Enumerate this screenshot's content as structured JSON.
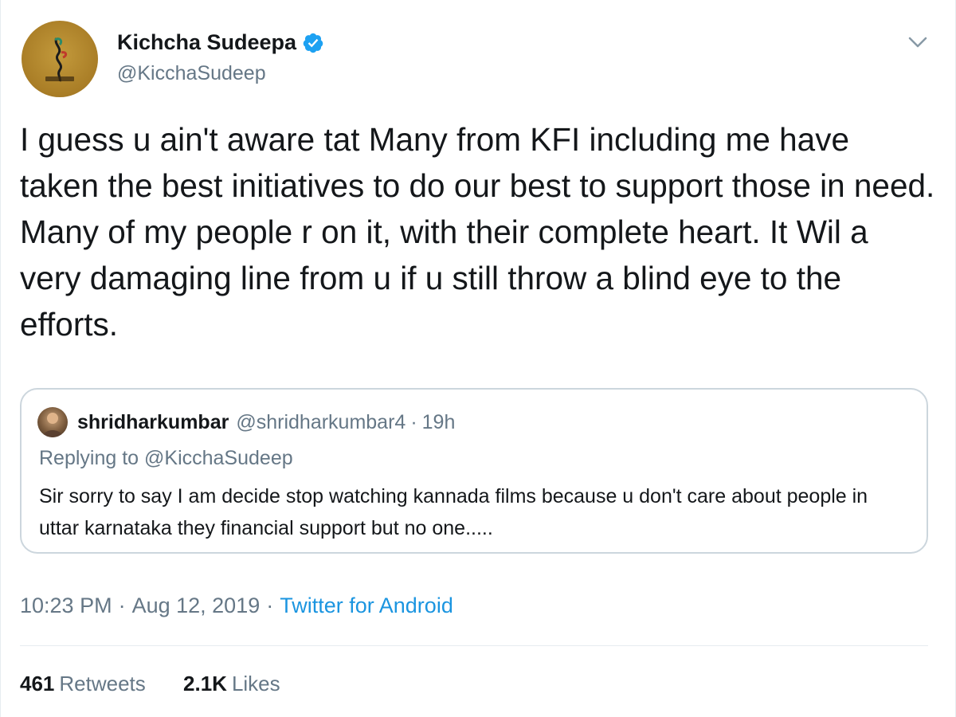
{
  "author": {
    "display_name": "Kichcha Sudeepa",
    "handle": "@KicchaSudeep",
    "avatar_icon": "profile-avatar",
    "verified_icon": "verified-badge-icon",
    "verified_color": "#1da1f2"
  },
  "menu": {
    "icon": "chevron-down-icon"
  },
  "tweet": {
    "text": "I guess u ain't aware tat Many from KFI including me have taken the best initiatives to do our best to support those in need. Many of my people r on it, with their complete heart. It Wil a very damaging line from u if u still throw a blind eye to the efforts."
  },
  "quoted": {
    "display_name": "shridharkumbar",
    "handle": "@shridharkumbar4",
    "separator": "·",
    "time": "19h",
    "replying_to": "Replying to @KicchaSudeep",
    "text": "Sir sorry to say I am decide stop watching kannada films because u don't care about people in uttar karnataka they financial support but no one....."
  },
  "meta": {
    "time": "10:23 PM",
    "separator": "·",
    "date": "Aug 12, 2019",
    "source": "Twitter for Android",
    "link_color": "#1b95e0"
  },
  "stats": {
    "retweets_count": "461",
    "retweets_label": "Retweets",
    "likes_count": "2.1K",
    "likes_label": "Likes"
  }
}
